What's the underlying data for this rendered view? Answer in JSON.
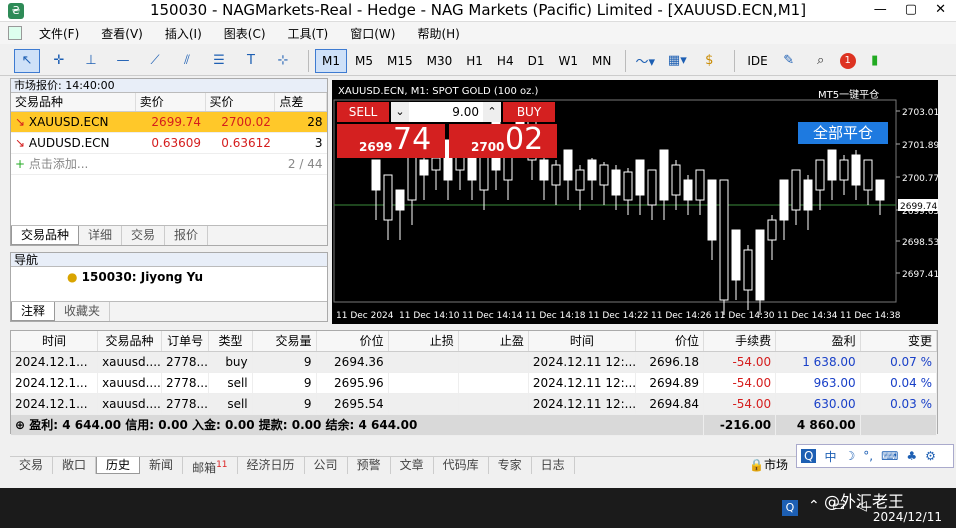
{
  "window": {
    "title": "150030 - NAGMarkets-Real - Hedge - NAG Markets (Pacific) Limited - [XAUUSD.ECN,M1]",
    "controls": [
      "—",
      "▢",
      "✕"
    ]
  },
  "menu": [
    "文件(F)",
    "查看(V)",
    "插入(I)",
    "图表(C)",
    "工具(T)",
    "窗口(W)",
    "帮助(H)"
  ],
  "toolbar": {
    "timeframes": [
      "M1",
      "M5",
      "M15",
      "M30",
      "H1",
      "H4",
      "D1",
      "W1",
      "MN"
    ],
    "active_tf": "M1",
    "ide": "IDE",
    "badge": "1"
  },
  "market_watch": {
    "title": "市场报价: 14:40:00",
    "columns": [
      "交易品种",
      "卖价",
      "买价",
      "点差"
    ],
    "rows": [
      {
        "symbol": "XAUUSD.ECN",
        "bid": "2699.74",
        "ask": "2700.02",
        "spread": "28"
      },
      {
        "symbol": "AUDUSD.ECN",
        "bid": "0.63609",
        "ask": "0.63612",
        "spread": "3"
      }
    ],
    "add_label": "点击添加...",
    "count": "2 / 44",
    "tabs": [
      "交易品种",
      "详细",
      "交易",
      "报价"
    ]
  },
  "navigator": {
    "title": "导航",
    "account": "150030: Jiyong Yu",
    "tabs": [
      "注释",
      "收藏夹"
    ]
  },
  "chart": {
    "header": "XAUUSD.ECN, M1:  SPOT GOLD (100 oz.)",
    "ea": "MT5一键平仓",
    "sell_label": "SELL",
    "buy_label": "BUY",
    "volume": "9.00",
    "sell_price_small": "2699",
    "sell_price_big": "74",
    "buy_price_small": "2700",
    "buy_price_big": "02",
    "close_all": "全部平仓",
    "current_price": "2699.74",
    "price_ticks": [
      "2703.01",
      "2701.89",
      "2700.77",
      "2699.65",
      "2698.53",
      "2697.41"
    ],
    "time_ticks": [
      "11 Dec 2024",
      "11 Dec 14:10",
      "11 Dec 14:14",
      "11 Dec 14:18",
      "11 Dec 14:22",
      "11 Dec 14:26",
      "11 Dec 14:30",
      "11 Dec 14:34",
      "11 Dec 14:38"
    ],
    "colors": {
      "bg": "#000000",
      "bull": "#ffffff",
      "bear": "#000000",
      "line": "#3c8c3c"
    }
  },
  "trade": {
    "columns": [
      "时间",
      "交易品种",
      "订单号",
      "类型",
      "交易量",
      "价位",
      "止损",
      "止盈",
      "时间",
      "价位",
      "手续费",
      "盈利",
      "变更"
    ],
    "rows": [
      {
        "t1": "2024.12.1...",
        "sym": "xauusd....",
        "order": "2778...",
        "type": "buy",
        "vol": "9",
        "p1": "2694.36",
        "sl": "",
        "tp": "",
        "t2": "2024.12.11 12:...",
        "p2": "2696.18",
        "fee": "-54.00",
        "profit": "1 638.00",
        "chg": "0.07 %"
      },
      {
        "t1": "2024.12.1...",
        "sym": "xauusd....",
        "order": "2778...",
        "type": "sell",
        "vol": "9",
        "p1": "2695.96",
        "sl": "",
        "tp": "",
        "t2": "2024.12.11 12:...",
        "p2": "2694.89",
        "fee": "-54.00",
        "profit": "963.00",
        "chg": "0.04 %"
      },
      {
        "t1": "2024.12.1...",
        "sym": "xauusd....",
        "order": "2778...",
        "type": "sell",
        "vol": "9",
        "p1": "2695.54",
        "sl": "",
        "tp": "",
        "t2": "2024.12.11 12:...",
        "p2": "2694.84",
        "fee": "-54.00",
        "profit": "630.00",
        "chg": "0.03 %"
      }
    ],
    "summary": "盈利: 4 644.00  信用: 0.00  入金: 0.00  提款: 0.00  结余: 4 644.00",
    "total_fee": "-216.00",
    "total_profit": "4 860.00"
  },
  "bottom_tabs": [
    "交易",
    "敞口",
    "历史",
    "新闻",
    "邮箱",
    "经济日历",
    "公司",
    "预警",
    "文章",
    "代码库",
    "专家",
    "日志"
  ],
  "mail_badge": "11",
  "market_label": "市场",
  "ime": [
    "中",
    "☽",
    "°,",
    "⌨",
    "♣",
    "⚙"
  ],
  "taskbar": {
    "date": "2024/12/11",
    "watermark": "@外汇老王"
  }
}
